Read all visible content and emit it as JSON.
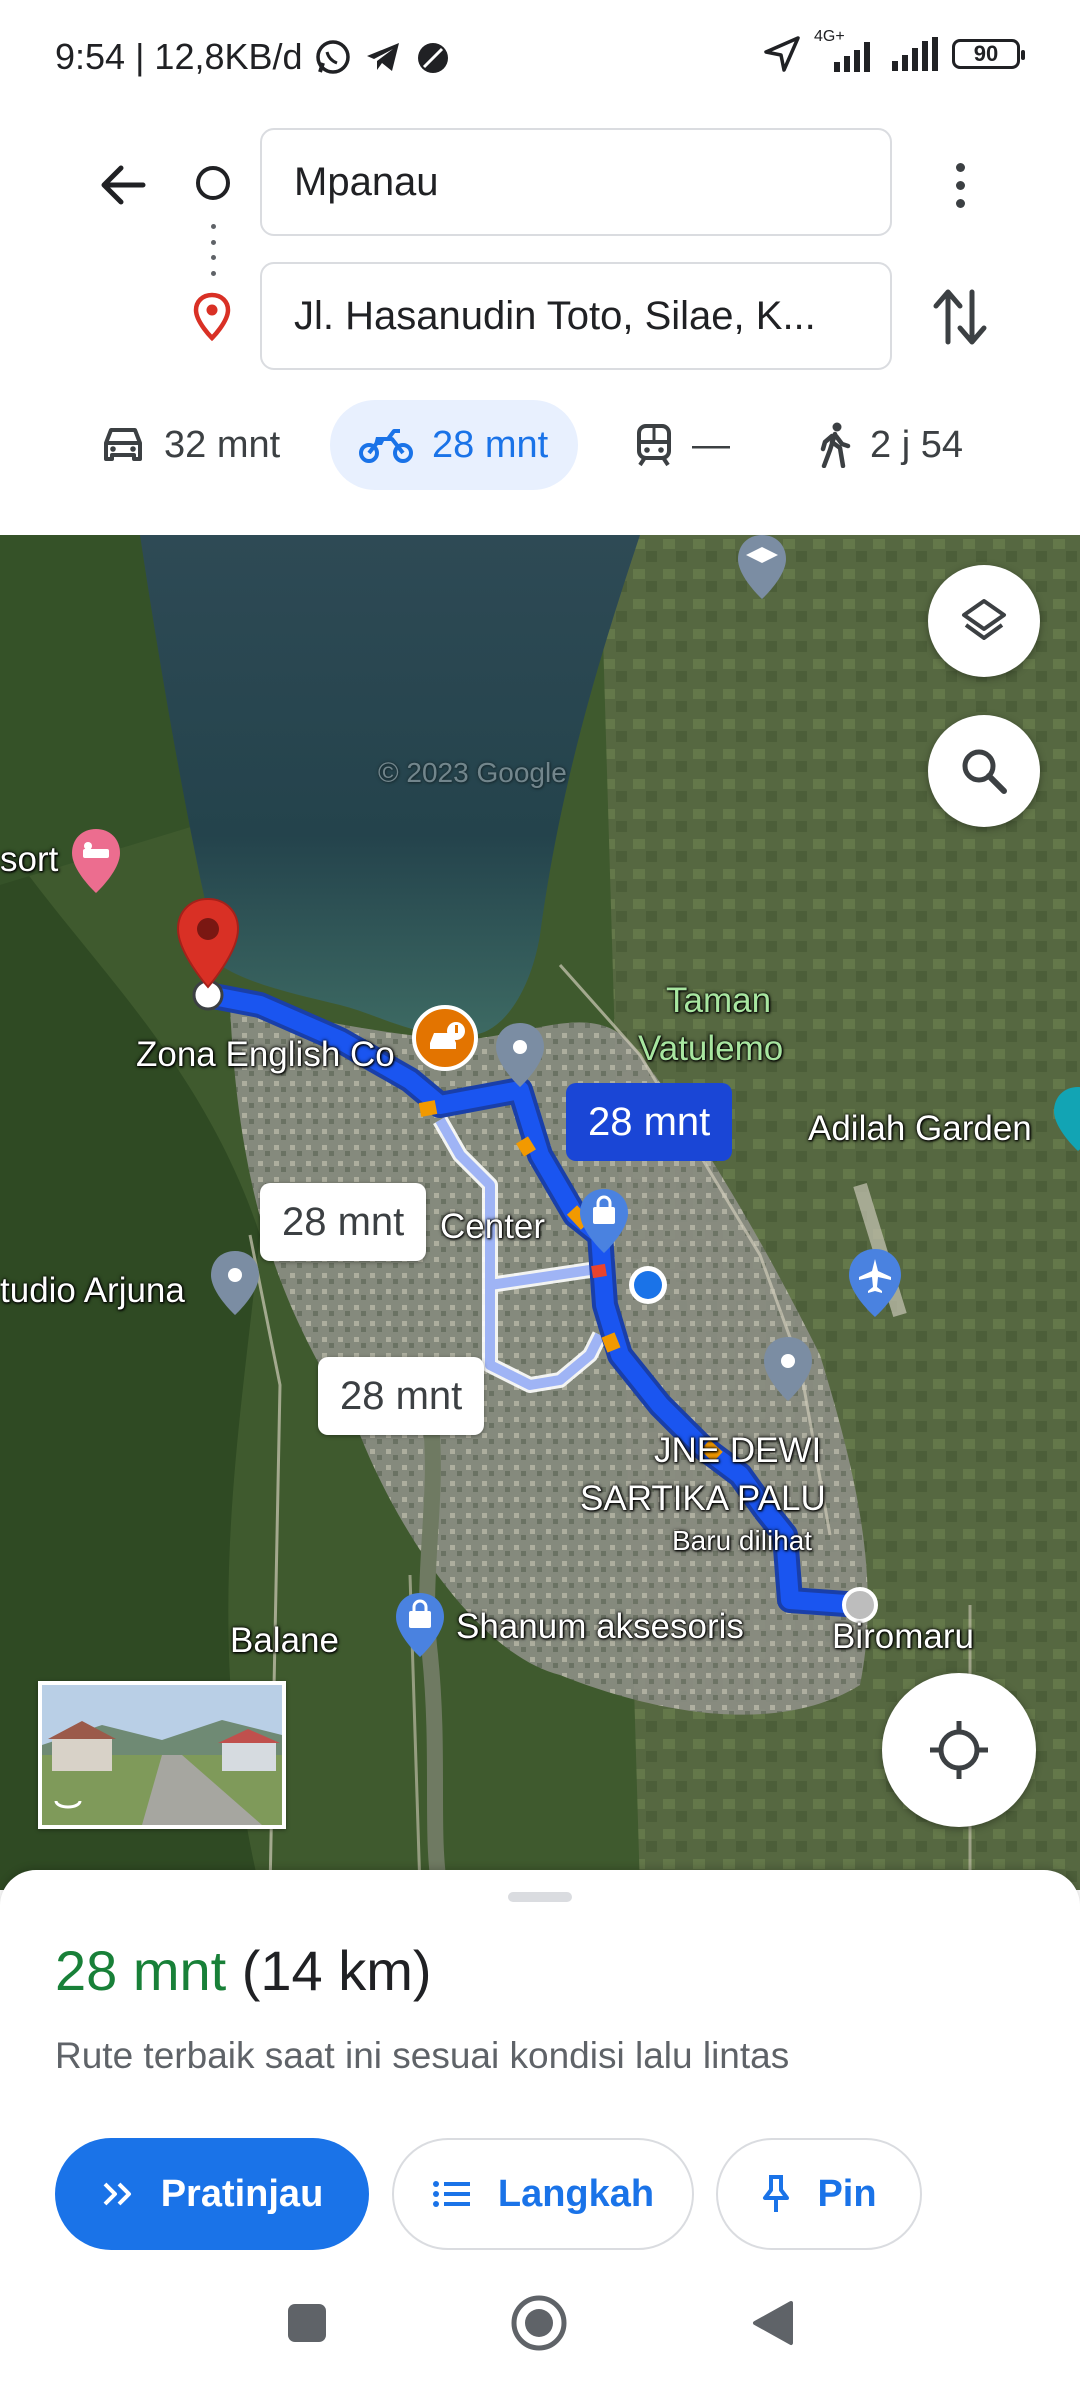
{
  "status_bar": {
    "time_and_speed": "9:54 | 12,8KB/d",
    "network_label": "4G+",
    "battery": "90",
    "icons": [
      "whatsapp-icon",
      "telegram-icon",
      "stopwatch-icon",
      "location-arrow-icon",
      "signal-icon",
      "signal-icon",
      "battery-icon"
    ]
  },
  "header": {
    "origin": "Mpanau",
    "destination": "Jl. Hasanudin Toto, Silae, K...",
    "icons": [
      "back-arrow-icon",
      "origin-circle-icon",
      "destination-pin-icon",
      "more-vertical-icon",
      "swap-icon"
    ]
  },
  "modes": [
    {
      "icon": "car-icon",
      "label": "32 mnt",
      "active": false
    },
    {
      "icon": "motorcycle-icon",
      "label": "28 mnt",
      "active": true
    },
    {
      "icon": "transit-icon",
      "label": "—",
      "active": false
    },
    {
      "icon": "walk-icon",
      "label": "2 j 54",
      "active": false
    }
  ],
  "map": {
    "labels": {
      "resort": "sort",
      "zona": "Zona English Co",
      "taman": "Taman\nVatulemo",
      "adilah": "Adilah Garden",
      "center": "Center",
      "arjuna": "tudio Arjuna",
      "jne": "JNE DEWI",
      "sartika": "SARTIKA PALU",
      "baru": "Baru dilihat",
      "balane": "Balane",
      "shanum": "Shanum aksesoris",
      "biromaru": "Biromaru",
      "watermark": "© 2023 Google"
    },
    "route_bubbles": {
      "primary": "28 mnt",
      "alt1": "28 mnt",
      "alt2": "28 mnt"
    },
    "colors": {
      "route_primary": "#1a46d6",
      "route_alt": "#9fb4f5",
      "destination_pin": "#d93025"
    }
  },
  "sheet": {
    "duration": "28 mnt",
    "distance": "(14 km)",
    "description": "Rute terbaik saat ini sesuai kondisi lalu lintas",
    "buttons": {
      "preview": "Pratinjau",
      "steps": "Langkah",
      "pin": "Pin"
    },
    "accent": "#1a73e8",
    "duration_color": "#188038"
  },
  "navbar": {
    "icons": [
      "recents-square-icon",
      "home-circle-icon",
      "back-triangle-icon"
    ]
  }
}
